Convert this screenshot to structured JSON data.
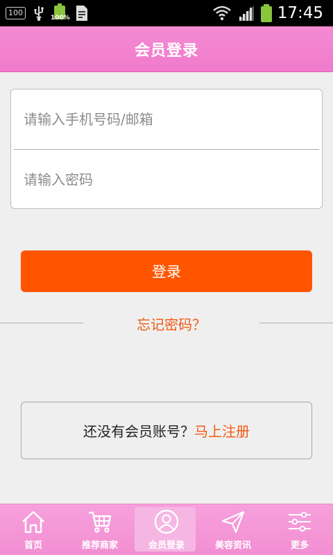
{
  "status_bar": {
    "badge": "100",
    "battery_small_pct": "100%",
    "time": "17:45"
  },
  "header": {
    "title": "会员登录"
  },
  "login_form": {
    "phone_placeholder": "请输入手机号码/邮箱",
    "password_placeholder": "请输入密码",
    "phone_value": "",
    "password_value": ""
  },
  "login_button_label": "登录",
  "forgot_password_label": "忘记密码？",
  "register": {
    "prompt": "还没有会员账号？",
    "link": "马上注册"
  },
  "bottom_nav": {
    "items": [
      {
        "label": "首页",
        "icon": "home-icon"
      },
      {
        "label": "推荐商家",
        "icon": "shopping-cart-icon"
      },
      {
        "label": "会员登录",
        "icon": "user-icon",
        "active": true
      },
      {
        "label": "美容资讯",
        "icon": "paper-plane-icon"
      },
      {
        "label": "更多",
        "icon": "sliders-icon"
      }
    ]
  },
  "colors": {
    "header_pink": "#f07acb",
    "accent_orange": "#ff5500",
    "link_orange": "#f25a12",
    "nav_pink": "#f28fd2",
    "battery_green": "#8ac43f"
  }
}
